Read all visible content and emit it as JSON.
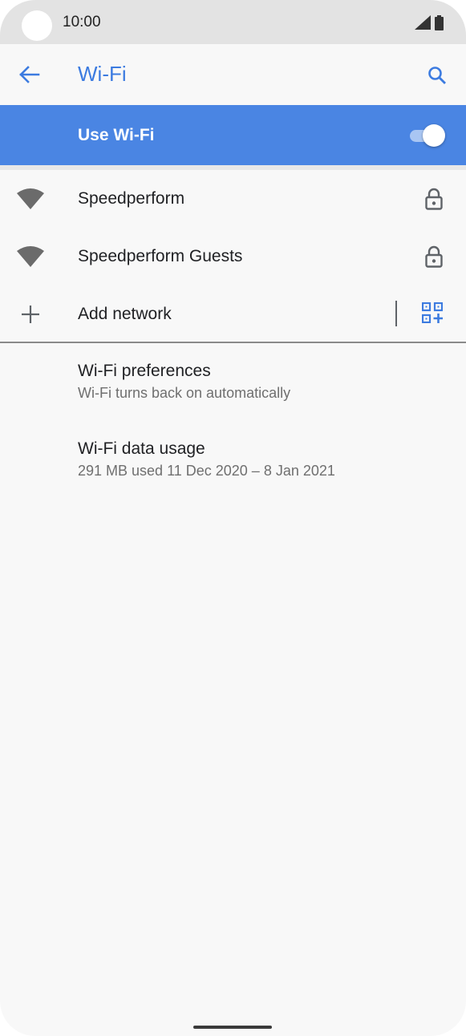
{
  "status_bar": {
    "time": "10:00",
    "icons": [
      "signal-icon",
      "battery-icon"
    ]
  },
  "app_bar": {
    "title": "Wi-Fi",
    "icons": [
      "back-arrow-icon",
      "search-icon"
    ]
  },
  "master_switch": {
    "label": "Use Wi-Fi",
    "checked": true
  },
  "networks": [
    {
      "name": "Speedperform",
      "icon": "wifi-icon",
      "secured": true
    },
    {
      "name": "Speedperform Guests",
      "icon": "wifi-icon",
      "secured": true
    }
  ],
  "add_network": {
    "label": "Add network",
    "icon": "plus-icon",
    "end_icon": "qr-code-icon"
  },
  "preferences": [
    {
      "title": "Wi-Fi preferences",
      "summary": "Wi-Fi turns back on automatically"
    },
    {
      "title": "Wi-Fi data usage",
      "summary": "291 MB used 11 Dec 2020 – 8 Jan 2021"
    }
  ],
  "colors": {
    "accent": "#3c7be0",
    "master_bar": "#4a85e3",
    "background": "#f8f8f8",
    "status_bar": "#e3e3e3"
  }
}
